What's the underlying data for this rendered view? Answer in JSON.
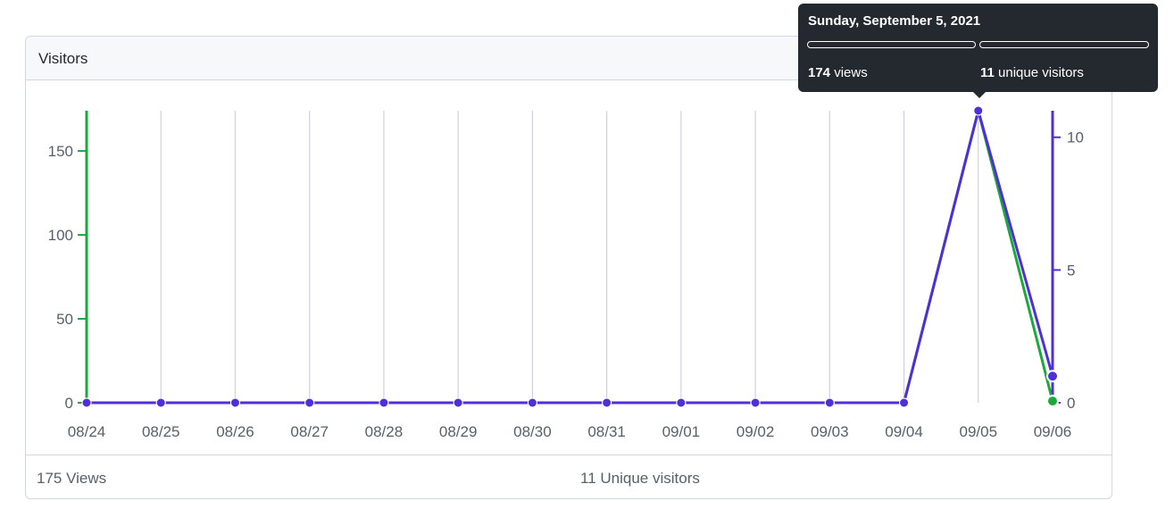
{
  "card": {
    "title": "Visitors",
    "footer_views": "175 Views",
    "footer_uniques": "11 Unique visitors"
  },
  "colors": {
    "views": "#1aaa3c",
    "uniques": "#4f2fd9",
    "grid": "#d0d0e0"
  },
  "tooltip": {
    "date": "Sunday, September 5, 2021",
    "views_count": "174",
    "views_label": "views",
    "uniques_count": "11",
    "uniques_label": "unique visitors"
  },
  "chart_data": {
    "type": "line",
    "categories": [
      "08/24",
      "08/25",
      "08/26",
      "08/27",
      "08/28",
      "08/29",
      "08/30",
      "08/31",
      "09/01",
      "09/02",
      "09/03",
      "09/04",
      "09/05",
      "09/06"
    ],
    "series": [
      {
        "values": [
          0,
          0,
          0,
          0,
          0,
          0,
          0,
          0,
          0,
          0,
          0,
          0,
          174,
          1
        ],
        "axis": "left"
      },
      {
        "values": [
          0,
          0,
          0,
          0,
          0,
          0,
          0,
          0,
          0,
          0,
          0,
          0,
          11,
          1
        ],
        "axis": "right"
      }
    ],
    "y_left": {
      "ticks": [
        "0",
        "50",
        "100",
        "150"
      ],
      "range": [
        0,
        174
      ]
    },
    "y_right": {
      "ticks": [
        "0",
        "5",
        "10"
      ],
      "range": [
        0,
        11
      ]
    },
    "grid": "vertical",
    "highlighted_category": "09/05"
  }
}
